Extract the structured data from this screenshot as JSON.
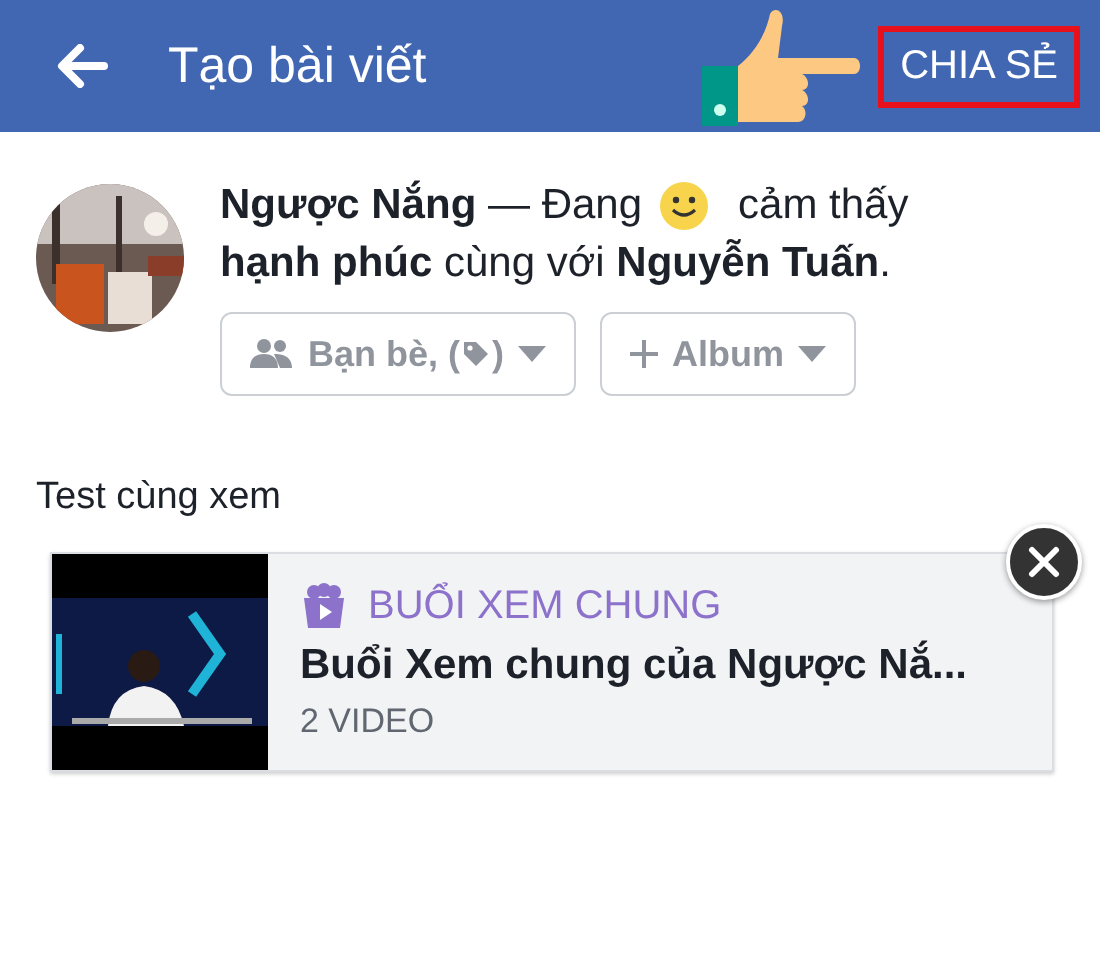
{
  "header": {
    "title": "Tạo bài viết",
    "share_button": {
      "label": "CHIA SẺ",
      "highlighted": true
    }
  },
  "status": {
    "lead": "**Ngược Nắng** — Đang",
    "feeling": "cảm thấy",
    "rest": "**hạnh phúc** cùng với **Nguyễn Tuấn**."
  },
  "audience": {
    "privacy_label": "Bạn bè, (",
    "privacy_close": ")",
    "album_label": "Album"
  },
  "post_text": "Test cùng xem",
  "attachment": {
    "category": "BUỔI XEM CHUNG",
    "title": "Buổi Xem chung của Ngược Nắ...",
    "subtitle": "2 VIDEO"
  }
}
